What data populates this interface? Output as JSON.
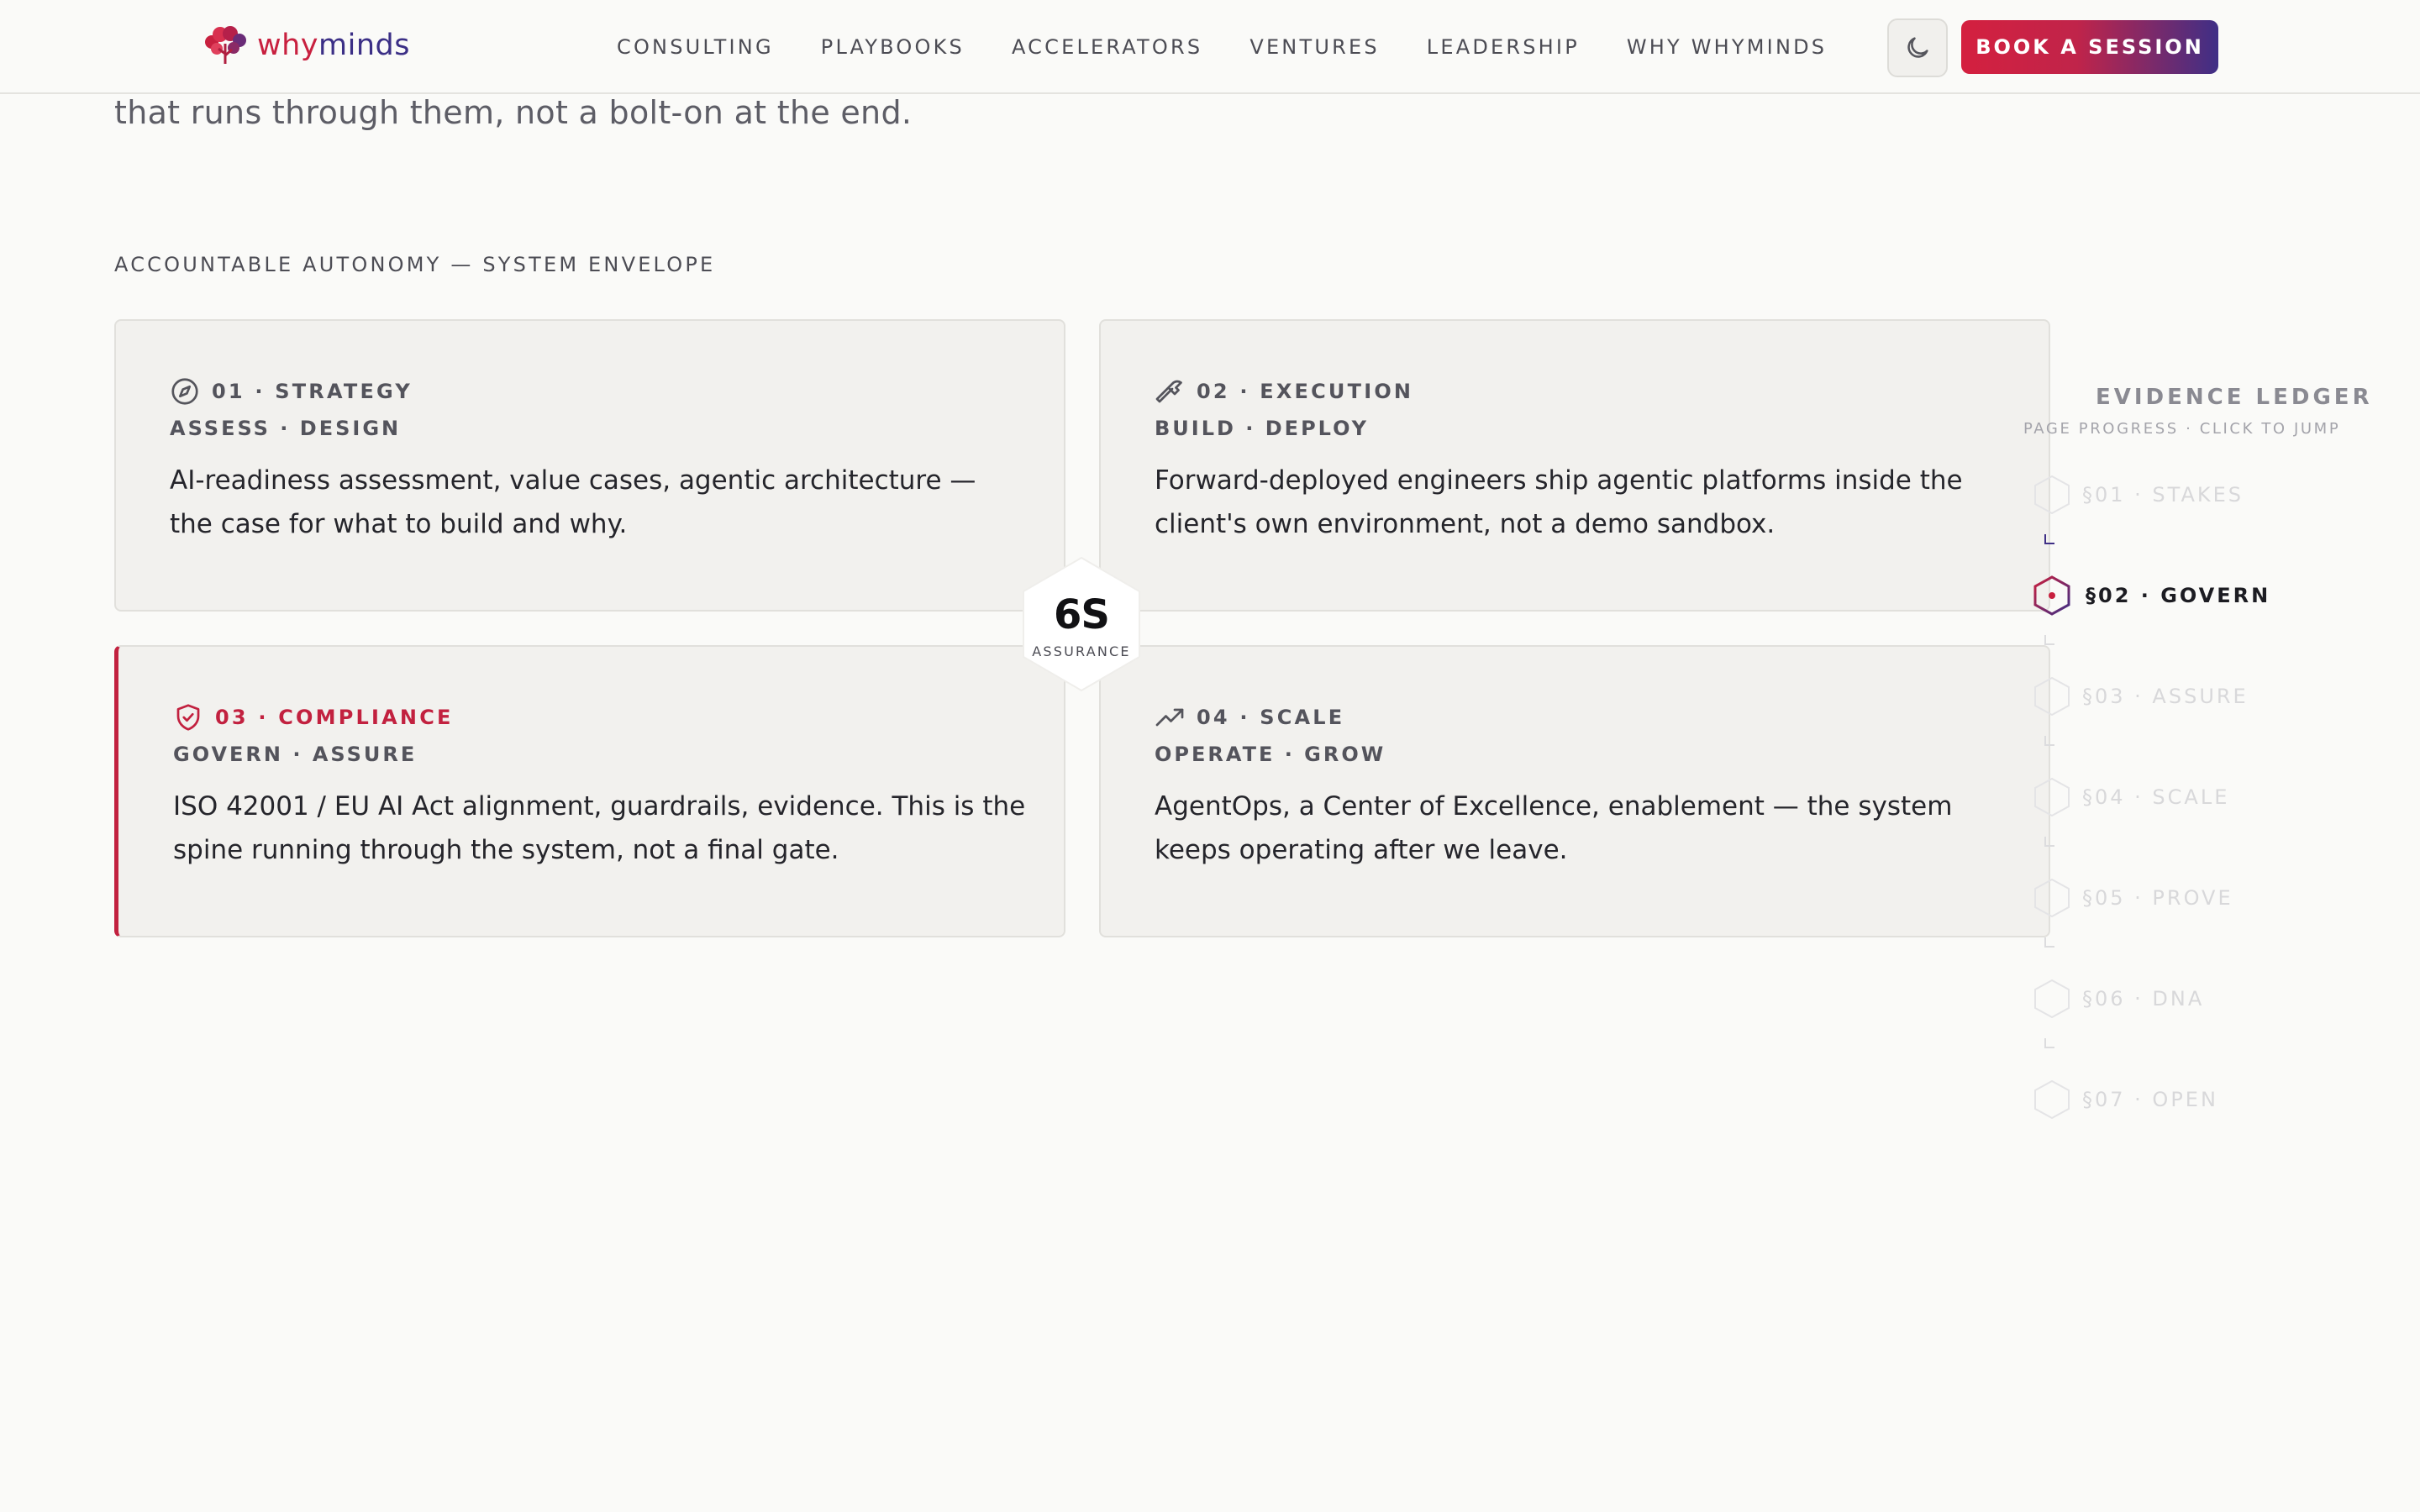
{
  "header": {
    "logo": {
      "why": "why",
      "minds": "minds"
    },
    "nav": [
      "CONSULTING",
      "PLAYBOOKS",
      "ACCELERATORS",
      "VENTURES",
      "LEADERSHIP",
      "WHY WHYMINDS"
    ],
    "theme_toggle_icon": "moon-icon",
    "cta_label": "BOOK A SESSION",
    "colors": {
      "brand_red": "#c8203f",
      "brand_indigo": "#3b2f86"
    }
  },
  "intro": {
    "text": "that runs through them, not a bolt-on at the end."
  },
  "section": {
    "label": "ACCOUNTABLE AUTONOMY — SYSTEM ENVELOPE"
  },
  "cards": [
    {
      "icon": "compass-icon",
      "title": "01 · STRATEGY",
      "subtitle": "ASSESS · DESIGN",
      "desc": "AI-readiness assessment, value cases, agentic architecture — the case for what to build and why."
    },
    {
      "icon": "hammer-icon",
      "title": "02 · EXECUTION",
      "subtitle": "BUILD · DEPLOY",
      "desc": "Forward-deployed engineers ship agentic platforms inside the client's own environment, not a demo sandbox."
    },
    {
      "icon": "shield-check-icon",
      "title": "03 · COMPLIANCE",
      "subtitle": "GOVERN · ASSURE",
      "desc": "ISO 42001 / EU AI Act alignment, guardrails, evidence. This is the spine running through the system, not a final gate."
    },
    {
      "icon": "trending-up-icon",
      "title": "04 · SCALE",
      "subtitle": "OPERATE · GROW",
      "desc": "AgentOps, a Center of Excellence, enablement — the system keeps operating after we leave."
    }
  ],
  "badge": {
    "main": "6S",
    "sub": "ASSURANCE"
  },
  "ledger": {
    "title": "EVIDENCE LEDGER",
    "subtitle": "PAGE PROGRESS · CLICK TO JUMP",
    "items": [
      "§01 · STAKES",
      "§02 · GOVERN",
      "§03 · ASSURE",
      "§04 · SCALE",
      "§05 · PROVE",
      "§06 · DNA",
      "§07 · OPEN"
    ],
    "active": "§02 · GOVERN"
  }
}
